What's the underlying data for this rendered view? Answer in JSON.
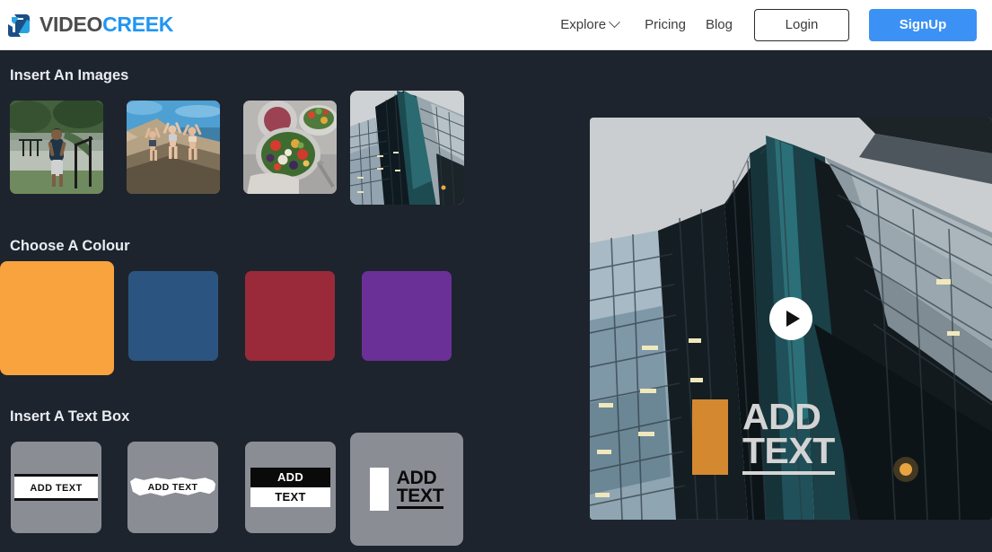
{
  "brand": {
    "name_part1": "VIDEO",
    "name_part2": "CREEK",
    "logo_icon": "videocreek-cube-icon",
    "color_part1": "#4d4d4d",
    "color_part2": "#2196f3"
  },
  "header": {
    "nav": [
      {
        "label": "Explore",
        "has_caret": true
      },
      {
        "label": "Pricing",
        "has_caret": false
      },
      {
        "label": "Blog",
        "has_caret": false
      }
    ],
    "login_label": "Login",
    "signup_label": "SignUp",
    "signup_color": "#3c91f5"
  },
  "sections": {
    "images": {
      "title": "Insert An Images",
      "tiles": [
        {
          "alt": "man-running-outdoors-thumbnail",
          "selected": false
        },
        {
          "alt": "people-jumping-on-beach-thumbnail",
          "selected": false
        },
        {
          "alt": "salad-bowl-food-thumbnail",
          "selected": false
        },
        {
          "alt": "glass-skyscraper-architecture-thumbnail",
          "selected": true
        }
      ]
    },
    "colour": {
      "title": "Choose A Colour",
      "swatches": [
        {
          "name": "orange",
          "hex": "#F9A33F",
          "selected": true
        },
        {
          "name": "steel-blue",
          "hex": "#2B5580",
          "selected": false
        },
        {
          "name": "crimson-red",
          "hex": "#9A2A3A",
          "selected": false
        },
        {
          "name": "purple",
          "hex": "#6B3097",
          "selected": false
        }
      ]
    },
    "textbox": {
      "title": "Insert A Text Box",
      "styles": [
        {
          "name": "ruled-lines",
          "line1": "ADD TEXT",
          "selected": false
        },
        {
          "name": "brush-stroke",
          "line1": "ADD TEXT",
          "selected": false
        },
        {
          "name": "split-bars",
          "line1": "ADD",
          "line2": "TEXT",
          "selected": false
        },
        {
          "name": "block-underline",
          "line1": "ADD",
          "line2": "TEXT",
          "selected": true
        }
      ]
    }
  },
  "preview": {
    "alt": "glass-skyscraper-looking-up-video-preview",
    "play_icon": "play-icon",
    "overlay": {
      "line1": "ADD",
      "line2": "TEXT",
      "bar_color": "#d4882f",
      "text_color": "#d4d4d4"
    }
  }
}
